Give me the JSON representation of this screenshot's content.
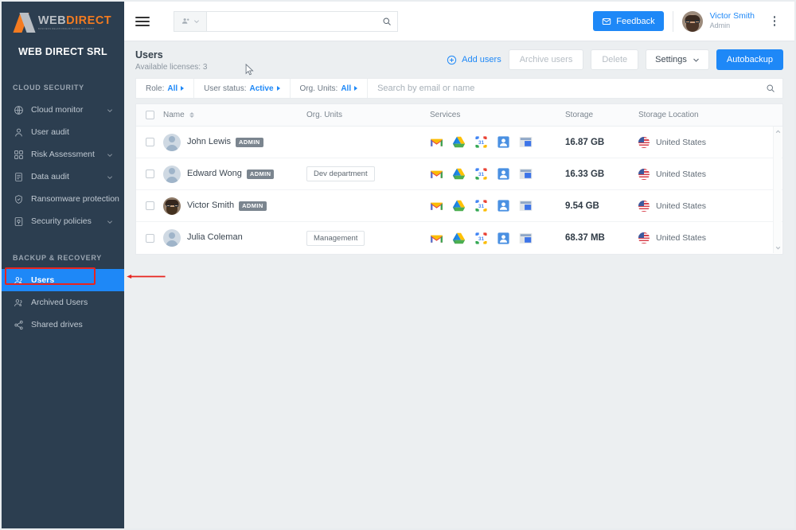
{
  "brand": {
    "logo_word_1": "WEB",
    "logo_word_2": "DIRECT",
    "logo_tagline": "BUSINESS RELATIONSHIP BASED ON TRUST",
    "company_name": "WEB DIRECT SRL"
  },
  "sidebar": {
    "section_cloud": "CLOUD SECURITY",
    "section_backup": "BACKUP & RECOVERY",
    "cloud_items": [
      {
        "label": "Cloud monitor",
        "icon": "globe-icon",
        "has_chevron": true
      },
      {
        "label": "User audit",
        "icon": "person-icon",
        "has_chevron": false
      },
      {
        "label": "Risk Assessment",
        "icon": "grid-icon",
        "has_chevron": true
      },
      {
        "label": "Data audit",
        "icon": "database-icon",
        "has_chevron": true
      },
      {
        "label": "Ransomware protection",
        "icon": "shield-icon",
        "has_chevron": false
      },
      {
        "label": "Security policies",
        "icon": "policy-icon",
        "has_chevron": true
      }
    ],
    "backup_items": [
      {
        "label": "Users",
        "icon": "users-icon",
        "active": true
      },
      {
        "label": "Archived Users",
        "icon": "users-icon",
        "active": false
      },
      {
        "label": "Shared drives",
        "icon": "share-icon",
        "active": false
      }
    ]
  },
  "topbar": {
    "menu_icon": "hamburger-icon",
    "search_scope_icon": "users-scope-icon",
    "search_value": "",
    "search_placeholder": "",
    "search_icon": "search-icon",
    "feedback_label": "Feedback",
    "feedback_icon": "envelope-icon",
    "user_name": "Victor Smith",
    "user_role": "Admin",
    "more_icon": "kebab-menu-icon"
  },
  "page": {
    "title": "Users",
    "subtitle": "Available licenses: 3",
    "add_users_label": "Add users",
    "add_users_icon": "plus-circle-icon",
    "archive_users_label": "Archive users",
    "delete_label": "Delete",
    "settings_label": "Settings",
    "settings_icon": "chevron-down-icon",
    "autobackup_label": "Autobackup"
  },
  "filters": {
    "role_label": "Role:",
    "role_value": "All",
    "status_label": "User status:",
    "status_value": "Active",
    "org_label": "Org. Units:",
    "org_value": "All",
    "search_placeholder": "Search by email or name",
    "search_value": "",
    "search_icon": "search-icon"
  },
  "table": {
    "headers": {
      "name": "Name",
      "org_units": "Org. Units",
      "services": "Services",
      "storage": "Storage",
      "storage_location": "Storage Location"
    },
    "rows": [
      {
        "name": "John Lewis",
        "badge": "ADMIN",
        "avatar_type": "generic",
        "org_unit": "",
        "services": [
          "gmail-icon",
          "drive-icon",
          "calendar-icon",
          "contacts-icon",
          "sites-icon"
        ],
        "storage": "16.87 GB",
        "location": "United States",
        "flag": "us-flag-icon",
        "expand_icon": "chevron-down-icon"
      },
      {
        "name": "Edward Wong",
        "badge": "ADMIN",
        "avatar_type": "generic",
        "org_unit": "Dev department",
        "services": [
          "gmail-icon",
          "drive-icon",
          "calendar-icon",
          "contacts-icon",
          "sites-icon"
        ],
        "storage": "16.33 GB",
        "location": "United States",
        "flag": "us-flag-icon",
        "expand_icon": "chevron-down-icon"
      },
      {
        "name": "Victor Smith",
        "badge": "ADMIN",
        "avatar_type": "photo",
        "org_unit": "",
        "services": [
          "gmail-icon",
          "drive-icon",
          "calendar-icon",
          "contacts-icon",
          "sites-icon"
        ],
        "storage": "9.54 GB",
        "location": "United States",
        "flag": "us-flag-icon",
        "expand_icon": "chevron-down-icon"
      },
      {
        "name": "Julia Coleman",
        "badge": "",
        "avatar_type": "generic",
        "org_unit": "Management",
        "services": [
          "gmail-icon",
          "drive-icon",
          "calendar-icon",
          "contacts-icon",
          "sites-icon"
        ],
        "storage": "68.37 MB",
        "location": "United States",
        "flag": "us-flag-icon",
        "expand_icon": "chevron-down-icon"
      }
    ]
  },
  "annotation": {
    "highlight_target": "BACKUP & RECOVERY",
    "color": "#e8241f",
    "shape": "rectangle-with-arrow"
  },
  "colors": {
    "accent": "#1e88f7",
    "sidebar": "#2c3e50",
    "annotation": "#e8241f",
    "logo_orange": "#f47b20"
  }
}
